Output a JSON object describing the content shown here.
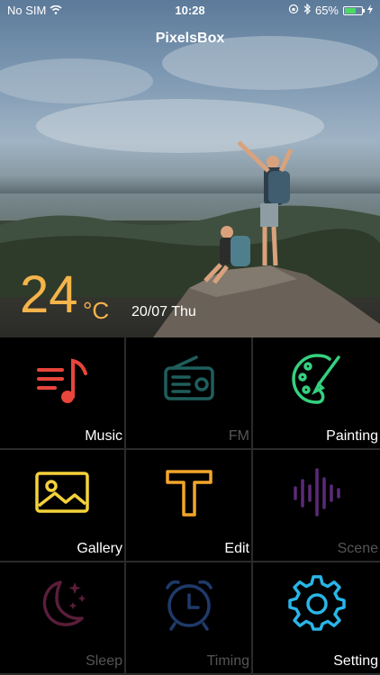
{
  "status": {
    "carrier": "No SIM",
    "time": "10:28",
    "battery": "65%",
    "battery_level": 0.65,
    "wifi_icon": "wifi-icon",
    "bluetooth_icon": "bluetooth-icon"
  },
  "app": {
    "title": "PixelsBox"
  },
  "weather": {
    "temperature": "24",
    "unit": "°C",
    "date": "20/07  Thu",
    "color": "#f5b44a"
  },
  "tiles": [
    {
      "label": "Music",
      "icon": "music-note-icon",
      "color": "#e8453c",
      "label_color": "#ffffff"
    },
    {
      "label": "FM",
      "icon": "radio-icon",
      "color": "#1f5e5c",
      "label_color": "#555555"
    },
    {
      "label": "Painting",
      "icon": "palette-brush-icon",
      "color": "#35d07f",
      "label_color": "#ffffff"
    },
    {
      "label": "Gallery",
      "icon": "image-icon",
      "color": "#f4d23a",
      "label_color": "#ffffff"
    },
    {
      "label": "Edit",
      "icon": "text-t-icon",
      "color": "#f4a52a",
      "label_color": "#ffffff"
    },
    {
      "label": "Scene",
      "icon": "sound-wave-icon",
      "color": "#5c2a78",
      "label_color": "#555555"
    },
    {
      "label": "Sleep",
      "icon": "moon-stars-icon",
      "color": "#5a1e3a",
      "label_color": "#555555"
    },
    {
      "label": "Timing",
      "icon": "alarm-clock-icon",
      "color": "#1f3a6a",
      "label_color": "#555555"
    },
    {
      "label": "Setting",
      "icon": "gear-icon",
      "color": "#29b6e8",
      "label_color": "#ffffff"
    }
  ]
}
